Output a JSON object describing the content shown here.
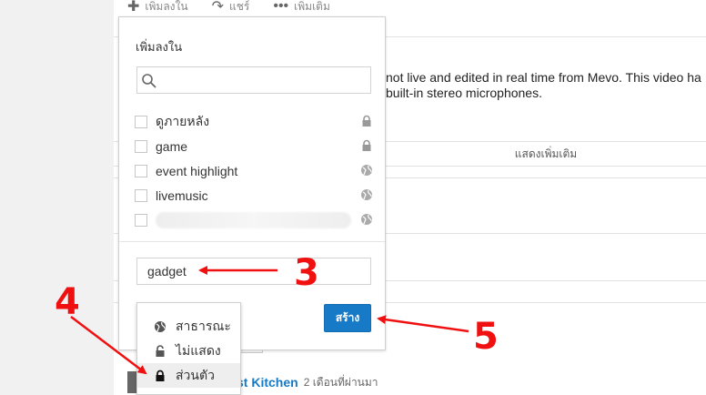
{
  "action_bar": {
    "add_to_label": "เพิ่มลงใน",
    "share_label": "แชร์",
    "more_label": "เพิ่มเติม"
  },
  "video": {
    "description_line1": "not live and edited in real time from Mevo. This video ha",
    "description_line2": "built-in stereo microphones.",
    "show_more_label": "แสดงเพิ่มเติม"
  },
  "related": {
    "title_fragment": "st Kitchen",
    "meta": "2 เดือนที่ผ่านมา"
  },
  "dialog": {
    "title": "เพิ่มลงใน",
    "search_value": "",
    "playlists": [
      {
        "name": "ดูภายหลัง",
        "privacy_icon": "lock-icon",
        "checked": false
      },
      {
        "name": "game",
        "privacy_icon": "lock-icon",
        "checked": false
      },
      {
        "name": "event highlight",
        "privacy_icon": "globe-icon",
        "checked": false
      },
      {
        "name": "livemusic",
        "privacy_icon": "globe-icon",
        "checked": false
      },
      {
        "name": "",
        "privacy_icon": "globe-icon",
        "checked": false,
        "blurred": true
      }
    ],
    "new_playlist_name": "gadget",
    "create_label": "สร้าง"
  },
  "privacy_menu": {
    "options": [
      {
        "label": "สาธารณะ",
        "icon": "globe-icon"
      },
      {
        "label": "ไม่แสดง",
        "icon": "unlock-icon"
      },
      {
        "label": "ส่วนตัว",
        "icon": "lock-icon",
        "selected": true
      }
    ]
  },
  "annotations": {
    "step_3": "3",
    "step_4": "4",
    "step_5": "5",
    "color": "#f01010"
  },
  "colors": {
    "accent": "#167ac6",
    "annotation": "#f01010"
  }
}
